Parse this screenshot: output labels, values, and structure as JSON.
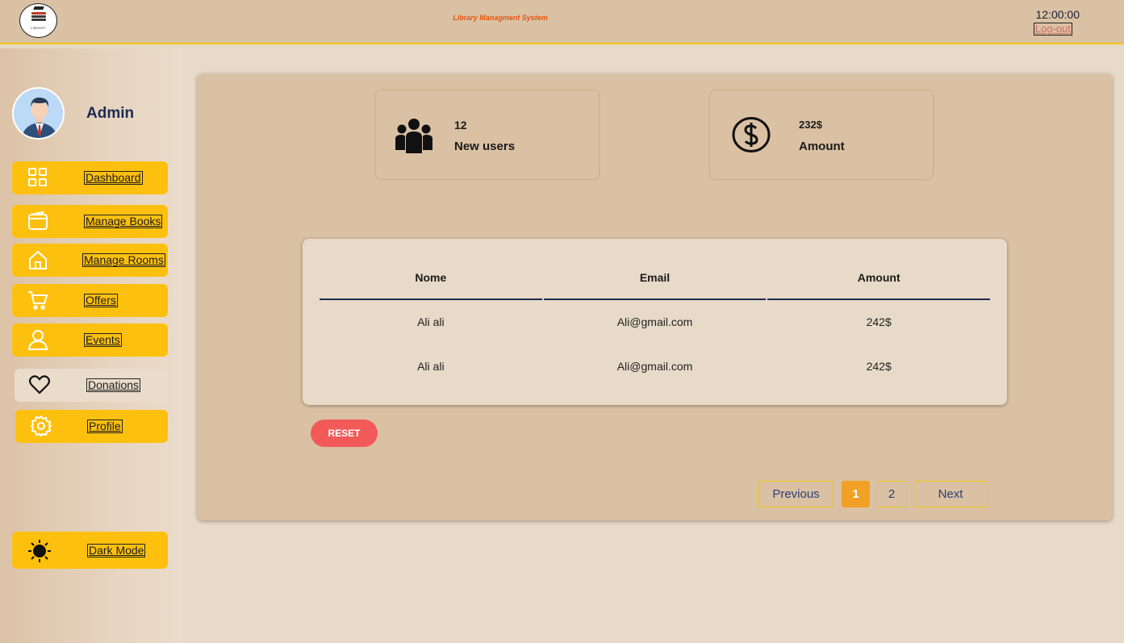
{
  "header": {
    "logo_text": "LIBRARY",
    "app_title": "Library Managment System",
    "clock": "12:00:00",
    "logout_label": "Log-out"
  },
  "sidebar": {
    "user_name": "Admin",
    "items": [
      {
        "label": "Dashboard",
        "icon": "grid-icon"
      },
      {
        "label": "Manage Books",
        "icon": "wallet-icon"
      },
      {
        "label": "Manage Rooms",
        "icon": "home-icon"
      },
      {
        "label": "Offers",
        "icon": "cart-icon"
      },
      {
        "label": "Events",
        "icon": "user-icon"
      },
      {
        "label": "Donations",
        "icon": "heart-icon"
      },
      {
        "label": "Profile",
        "icon": "gear-icon"
      }
    ],
    "dark_mode_label": "Dark Mode"
  },
  "stats": {
    "users": {
      "value": "12",
      "label": "New users",
      "icon": "users-icon"
    },
    "amount": {
      "value": "232$",
      "label": "Amount",
      "icon": "dollar-circle-icon"
    }
  },
  "table": {
    "columns": [
      "Nome",
      "Email",
      "Amount"
    ],
    "rows": [
      [
        "Ali ali",
        "Ali@gmail.com",
        "242$"
      ],
      [
        "Ali ali",
        "Ali@gmail.com",
        "242$"
      ]
    ]
  },
  "reset_label": "RESET",
  "pagination": {
    "previous": "Previous",
    "pages": [
      "1",
      "2"
    ],
    "current": "1",
    "next": "Next"
  },
  "colors": {
    "accent": "#fec00f",
    "background": "#dac1a3",
    "reset": "#f25a5a",
    "current_page": "#f2a026",
    "title": "#e8540e"
  }
}
